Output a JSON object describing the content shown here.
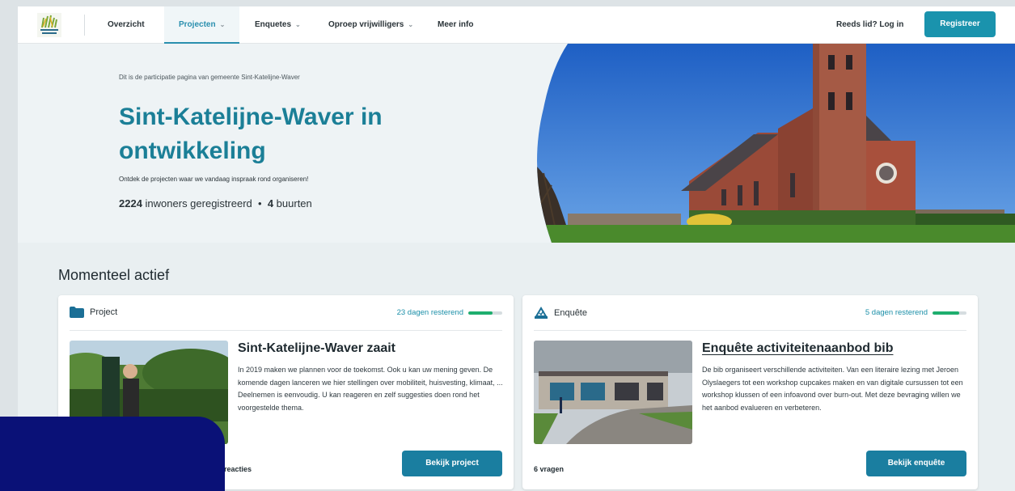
{
  "nav": {
    "items": [
      {
        "label": "Overzicht",
        "dropdown": false
      },
      {
        "label": "Projecten",
        "dropdown": true,
        "active": true
      },
      {
        "label": "Enquetes",
        "dropdown": true
      },
      {
        "label": "Oproep vrijwilligers",
        "dropdown": true
      },
      {
        "label": "Meer info",
        "dropdown": false
      }
    ],
    "login": "Reeds lid? Log in",
    "register": "Registreer"
  },
  "hero": {
    "intro": "Dit is de participatie pagina van gemeente Sint-Katelijne-Waver",
    "title": "Sint-Katelijne-Waver in ontwikkeling",
    "subtitle": "Ontdek de projecten waar we vandaag inspraak rond organiseren!",
    "residents_count": "2224",
    "residents_label": "inwoners geregistreerd",
    "separator": "•",
    "neighbourhoods_count": "4",
    "neighbourhoods_label": "buurten"
  },
  "active": {
    "title": "Momenteel actief",
    "cards": [
      {
        "type": "Project",
        "days_left": "23 dagen resterend",
        "progress": 0.72,
        "title": "Sint-Katelijne-Waver zaait",
        "text": "In 2019 maken we plannen voor de toekomst. Ook u kan uw mening geven. De komende dagen lanceren we hier stellingen over mobiliteit, huisvesting, klimaat, ... Deelnemen is eenvoudig. U kan reageren en zelf suggesties doen rond het voorgestelde thema.",
        "footer": "reacties",
        "button": "Bekijk project"
      },
      {
        "type": "Enquête",
        "days_left": "5 dagen resterend",
        "progress": 0.78,
        "title": "Enquête activiteitenaanbod bib",
        "text": "De bib organiseert verschillende activiteiten. Van een literaire lezing met Jeroen Olyslaegers tot een workshop cupcakes maken en van digitale cursussen tot een workshop klussen of een infoavond over burn-out. Met deze bevraging willen we het aanbod evalueren en verbeteren.",
        "footer": "6 vragen",
        "button": "Bekijk enquête"
      }
    ]
  },
  "colors": {
    "accent": "#1b7f97",
    "button": "#1a7ea0",
    "progress": "#1fae6e",
    "overlay": "#0a1177"
  }
}
